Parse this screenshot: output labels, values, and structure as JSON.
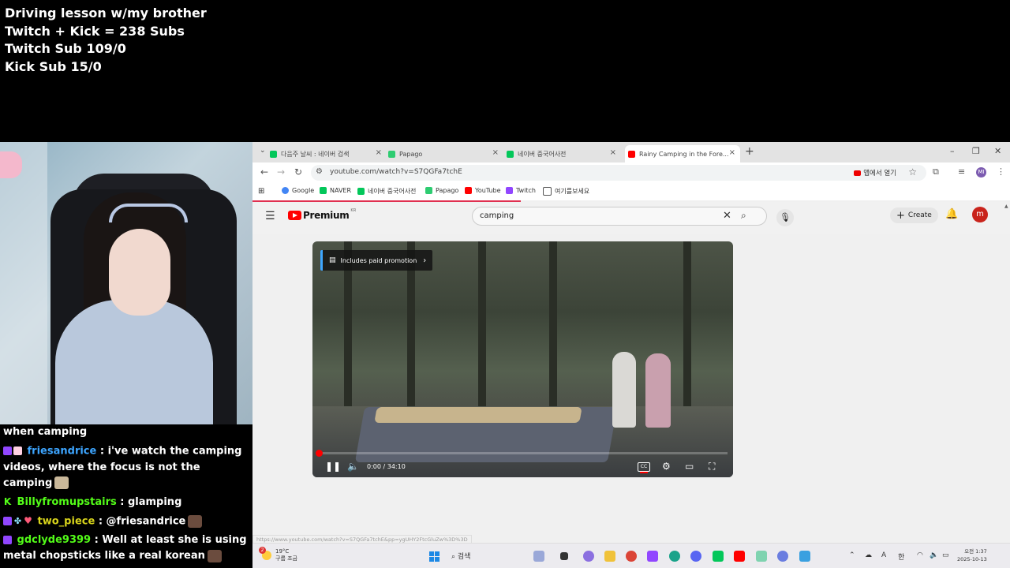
{
  "overlay": {
    "line1": "Driving lesson w/my brother",
    "line2": "Twitch + Kick = 238 Subs",
    "line3": "Twitch Sub 109/0",
    "line4": "Kick Sub 15/0"
  },
  "chat": {
    "messages": [
      {
        "user": "",
        "text": "when camping"
      },
      {
        "user": "friesandrice",
        "text": " : i've watch the camping videos, where the focus is not the camping"
      },
      {
        "user": "Billyfromupstairs",
        "text": " : glamping"
      },
      {
        "user": "two_piece",
        "text": " : @friesandrice"
      },
      {
        "user": "gdclyde9399",
        "text": " : Well at least she is using metal chopsticks like a real korean"
      },
      {
        "user": "friesandrice",
        "text": " :"
      }
    ]
  },
  "browser": {
    "tabs": [
      {
        "label": "다음주 날씨 : 네이버 검색"
      },
      {
        "label": "Papago"
      },
      {
        "label": "네이버 중국어사전"
      },
      {
        "label": "Rainy Camping in the Fore..."
      }
    ],
    "url": "youtube.com/watch?v=S7QGFa7tchE",
    "open_in_app": "앱에서 열기",
    "profile_initials": "MI",
    "bookmarks": [
      "Google",
      "NAVER",
      "네이버 중국어사전",
      "Papago",
      "YouTube",
      "Twitch",
      "여기를보세요"
    ]
  },
  "youtube": {
    "logo_word": "Premium",
    "logo_region": "KR",
    "search_query": "camping",
    "create_label": "Create",
    "avatar_letter": "m",
    "video": {
      "promo_label": "Includes paid promotion",
      "time": "0:00 / 34:10",
      "progress": 0.0
    },
    "status_url": "https://www.youtube.com/watch?v=S7QGFa7tchE&pp=ygUHY2FtcGluZw%3D%3D"
  },
  "taskbar": {
    "temp": "19°C",
    "weather_text": "구름 조금",
    "notif_count": "2",
    "search_label": "검색",
    "time": "오전 1:37",
    "date": "2025-10-13"
  },
  "colors": {
    "twitch": "#9146ff",
    "kick": "#53fc18",
    "youtube_red": "#ff0000"
  }
}
